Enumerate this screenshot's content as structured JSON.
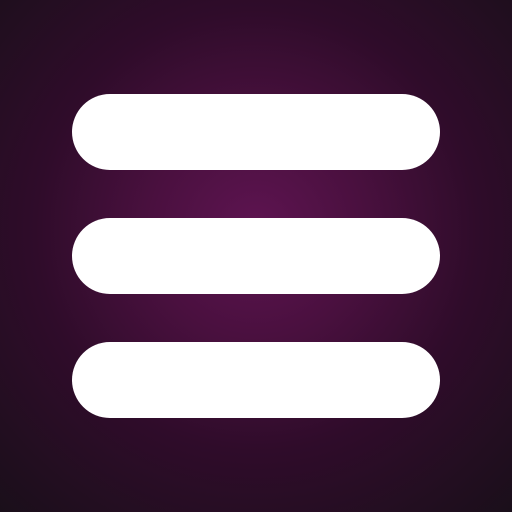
{
  "icon": {
    "name": "hamburger-menu-icon",
    "bar_count": 3,
    "colors": {
      "background_center": "#5e1451",
      "background_edge": "#1a0f1a",
      "bar": "#ffffff"
    }
  }
}
